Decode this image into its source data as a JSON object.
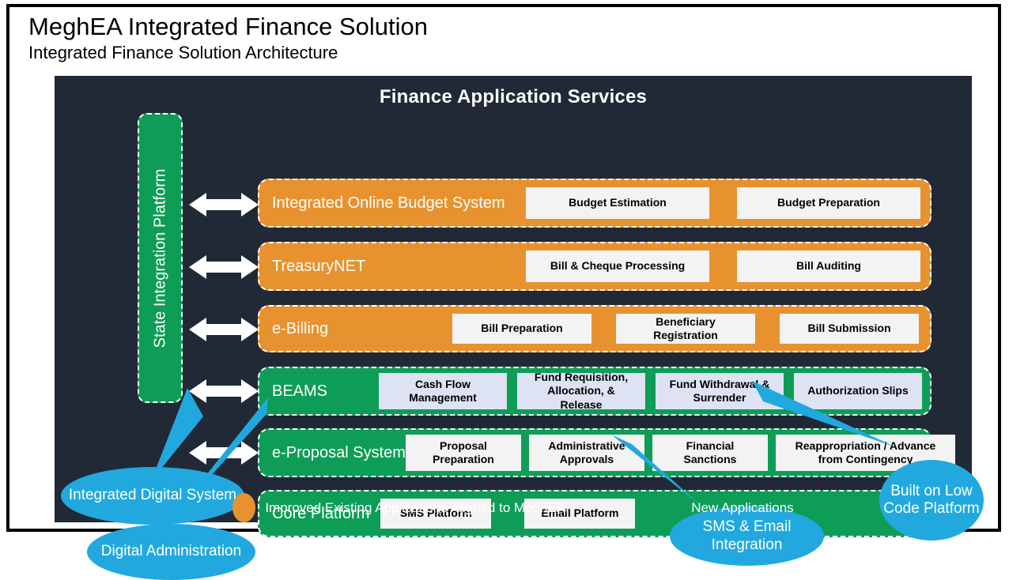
{
  "colors": {
    "orange": "#E8922F",
    "green": "#0E9D57",
    "dark_panel": "#212936",
    "callout_blue": "#21A9DF",
    "chip_white": "#F3F3F3",
    "chip_blue": "#DDE3F2"
  },
  "header": {
    "title": "MeghEA Integrated Finance Solution",
    "subtitle": "Integrated Finance Solution Architecture"
  },
  "panel": {
    "title": "Finance Application Services",
    "sidebar_label": "State Integration Platform"
  },
  "rows": [
    {
      "label": "Integrated Online Budget System",
      "type": "orange",
      "items": [
        "Budget Estimation",
        "Budget Preparation"
      ]
    },
    {
      "label": "TreasuryNET",
      "type": "orange",
      "items": [
        "Bill & Cheque Processing",
        "Bill Auditing"
      ]
    },
    {
      "label": "e-Billing",
      "type": "orange",
      "items": [
        "Bill Preparation",
        "Beneficiary Registration",
        "Bill Submission"
      ]
    },
    {
      "label": "BEAMS",
      "type": "green",
      "items": [
        "Cash Flow Management",
        "Fund Requisition, Allocation, & Release",
        "Fund Withdrawal & Surrender",
        "Authorization Slips"
      ]
    },
    {
      "label": "e-Proposal System",
      "type": "green",
      "items": [
        "Proposal Preparation",
        "Administrative Approvals",
        "Financial Sanctions",
        "Reappropriation / Advance from Contingency"
      ]
    },
    {
      "label": "Core Platform",
      "type": "green",
      "items": [
        "SMS Platform",
        "Email Platform"
      ]
    }
  ],
  "callouts": {
    "integrated_digital_system": "Integrated Digital System",
    "digital_administration": "Digital Administration",
    "sms_email_integration": "SMS & Email Integration",
    "built_on_low_code": "Built on Low Code Platform"
  },
  "legend": [
    {
      "label": "Improved Existing Applications Aligned to MeghEA",
      "color": "orange"
    },
    {
      "label": "New Applications",
      "color": "green"
    }
  ],
  "arrow_count": 5
}
